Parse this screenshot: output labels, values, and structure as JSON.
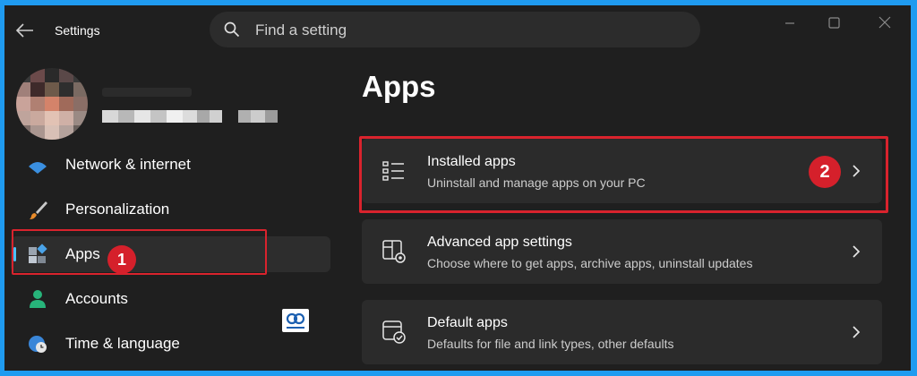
{
  "window": {
    "title": "Settings",
    "controls": [
      "minimize-icon",
      "maximize-icon",
      "close-icon"
    ]
  },
  "search": {
    "placeholder": "Find a setting"
  },
  "sidebar": {
    "items": [
      {
        "label": "Network & internet",
        "icon": "wifi-icon",
        "selected": false
      },
      {
        "label": "Personalization",
        "icon": "brush-icon",
        "selected": false
      },
      {
        "label": "Apps",
        "icon": "apps-icon",
        "selected": true
      },
      {
        "label": "Accounts",
        "icon": "person-icon",
        "selected": false
      },
      {
        "label": "Time & language",
        "icon": "globe-clock-icon",
        "selected": false
      }
    ]
  },
  "main": {
    "title": "Apps",
    "cards": [
      {
        "title": "Installed apps",
        "subtitle": "Uninstall and manage apps on your PC",
        "icon": "list-icon"
      },
      {
        "title": "Advanced app settings",
        "subtitle": "Choose where to get apps, archive apps, uninstall updates",
        "icon": "app-settings-icon"
      },
      {
        "title": "Default apps",
        "subtitle": "Defaults for file and link types, other defaults",
        "icon": "default-apps-icon"
      }
    ]
  },
  "annotations": {
    "step1": "1",
    "step2": "2",
    "color": "#d5202b"
  },
  "colors": {
    "background": "#1f1f1f",
    "card": "#2b2b2b",
    "accent": "#4cc2ff",
    "frame_border": "#1f9bf0"
  }
}
